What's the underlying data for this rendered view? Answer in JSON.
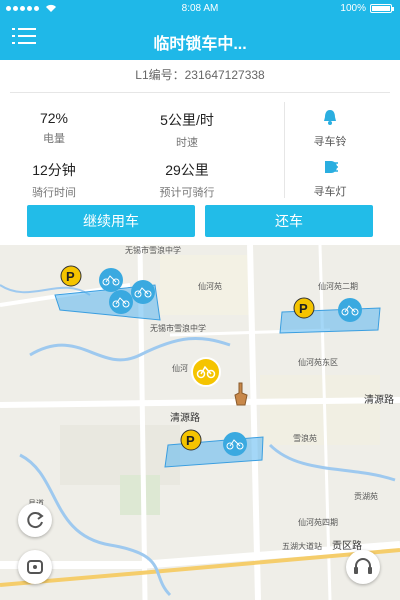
{
  "status": {
    "time": "8:08 AM",
    "battery": "100%"
  },
  "header": {
    "title": "临时锁车中..."
  },
  "info": {
    "id_text": "L1编号：231647127338"
  },
  "stats": [
    {
      "value": "72%",
      "label": "电量"
    },
    {
      "value": "5公里/时",
      "label": "时速"
    },
    {
      "value": "12分钟",
      "label": "骑行时间"
    },
    {
      "value": "29公里",
      "label": "预计可骑行"
    }
  ],
  "actions": {
    "bell_label": "寻车铃",
    "light_label": "寻车灯"
  },
  "buttons": {
    "continue": "继续用车",
    "return": "还车"
  },
  "map": {
    "labels": [
      "无锡市雪浪中学",
      "无锡市雪浪中学",
      "仙河苑",
      "仙河苑二期",
      "仙河苑东区",
      "仙河",
      "雪浪苑",
      "仙河苑四期",
      "贡湖苑",
      "五湖大道站",
      "县道"
    ],
    "roads": [
      "清源路",
      "清源路",
      "贡区路"
    ]
  },
  "colors": {
    "primary": "#1fb8e8",
    "parking": "#f5c400",
    "bike": "#3aa9e0"
  }
}
